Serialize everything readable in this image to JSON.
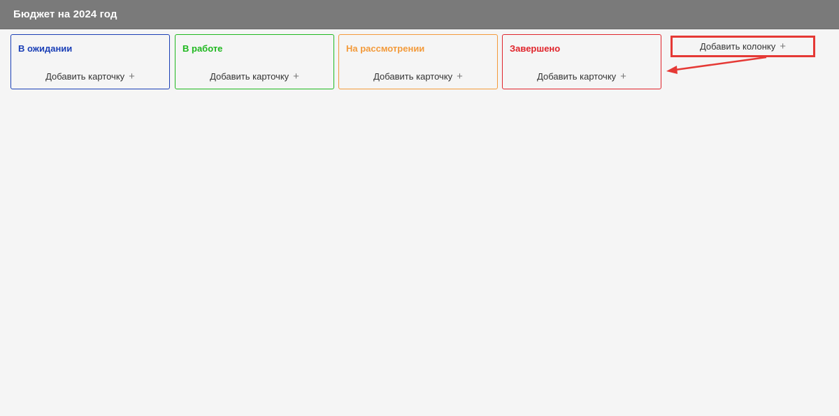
{
  "header": {
    "title": "Бюджет на 2024 год"
  },
  "columns": [
    {
      "title": "В ожидании",
      "color": "#1a3fb6",
      "add_card_label": "Добавить карточку",
      "plus": "+"
    },
    {
      "title": "В работе",
      "color": "#1fb81f",
      "add_card_label": "Добавить карточку",
      "plus": "+"
    },
    {
      "title": "На рассмотрении",
      "color": "#f39a3a",
      "add_card_label": "Добавить карточку",
      "plus": "+"
    },
    {
      "title": "Завершено",
      "color": "#e0242b",
      "add_card_label": "Добавить карточку",
      "plus": "+"
    }
  ],
  "add_column": {
    "label": "Добавить колонку",
    "plus": "+"
  },
  "annotation": {
    "highlight_color": "#e53935",
    "arrow_color": "#e53935"
  }
}
